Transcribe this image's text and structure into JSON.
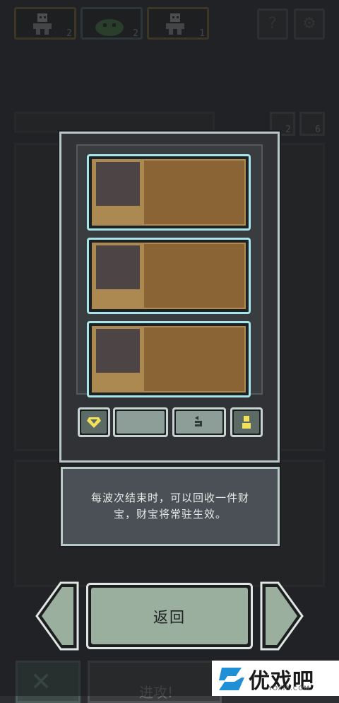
{
  "top_bar": {
    "units": [
      {
        "name": "skeleton-unit",
        "count": "2"
      },
      {
        "name": "slime-unit",
        "count": "2"
      },
      {
        "name": "skeleton-unit",
        "count": "1"
      }
    ],
    "help_icon": "question-mark-icon",
    "settings_icon": "gear-icon"
  },
  "side_counters": {
    "refresh_count": "2",
    "unit_count": "6"
  },
  "treasure_panel": {
    "cards": [
      {
        "slot": "treasure-1"
      },
      {
        "slot": "treasure-2"
      },
      {
        "slot": "treasure-3"
      }
    ],
    "buttons": [
      {
        "icon": "diamond-icon"
      },
      {
        "icon": "blank"
      },
      {
        "icon": "refresh-icon"
      },
      {
        "icon": "person-icon"
      }
    ]
  },
  "info": {
    "line1": "每波次结束时，可以回收一件财",
    "line2": "宝，财宝将常驻生效。"
  },
  "navigation": {
    "return_label": "返回"
  },
  "background": {
    "start_label": "进攻!"
  },
  "watermark": {
    "brand": "优戏吧",
    "domain": "YOXI8.COM"
  },
  "colors": {
    "popup_border": "#b9c7c8",
    "card_border": "#a6e6ea",
    "treasure_fill": "#8a6434",
    "return_button": "#9baf9f"
  }
}
